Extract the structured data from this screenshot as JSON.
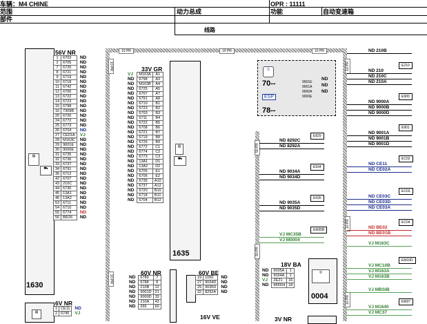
{
  "header": {
    "vehicle_label": "车辆：M4 CHINE",
    "opr_label": "OPR : 11111",
    "scope_label": "范围",
    "scope_value": "动力总成",
    "function_label": "功能",
    "function_value": "自动变速箱",
    "part_label": "部件",
    "section_title": "线路"
  },
  "harness_tags": [
    "10 PR",
    "10 PR",
    "10 PR",
    "10 PR",
    "10 PR",
    "50 PR",
    "50 PR",
    "10 PR",
    "10 PR",
    "10 PR"
  ],
  "conn_1630": {
    "title": "56V NR",
    "number": "1630",
    "pins": [
      [
        "1",
        "6703",
        "ND"
      ],
      [
        "2",
        "6705",
        "ND"
      ],
      [
        "7",
        "6720",
        "ND"
      ],
      [
        "8",
        "6721",
        "ND"
      ],
      [
        "9",
        "6719",
        "ND"
      ],
      [
        "10",
        "6718",
        "ND"
      ],
      [
        "11",
        "6742",
        "ND"
      ],
      [
        "12",
        "6706",
        "ND"
      ],
      [
        "13",
        "6722",
        "ND"
      ],
      [
        "14",
        "6723",
        "ND"
      ],
      [
        "15",
        "6798",
        "ND"
      ],
      [
        "16",
        "7309B",
        "ND"
      ],
      [
        "20",
        "6726",
        "ND"
      ],
      [
        "24",
        "6772",
        "ND"
      ],
      [
        "25",
        "6773",
        "ND"
      ],
      [
        "26",
        "6704",
        "ND"
      ],
      [
        "27",
        "CE01A",
        "VJ"
      ],
      [
        "28",
        "M163C",
        "ND"
      ],
      [
        "29",
        "9001E",
        "ND"
      ],
      [
        "30",
        "9000E",
        "ND"
      ],
      [
        "31",
        "6735",
        "ND"
      ],
      [
        "32",
        "6736",
        "ND"
      ],
      [
        "33",
        "6737",
        "ND"
      ],
      [
        "34",
        "6791",
        "ND"
      ],
      [
        "36",
        "6712",
        "ND"
      ],
      [
        "42",
        "6707",
        "ND"
      ],
      [
        "43",
        "210C",
        "ND"
      ],
      [
        "44",
        "6730",
        "ND"
      ],
      [
        "45",
        "13A1",
        "ND"
      ],
      [
        "46",
        "13A2",
        "ND"
      ],
      [
        "53",
        "6711",
        "ND"
      ],
      [
        "54",
        "6710",
        "ND"
      ],
      [
        "55",
        "6774",
        "ND"
      ],
      [
        "56",
        "BR26",
        "ND"
      ]
    ],
    "pin_colors": [
      "black",
      "black",
      "black",
      "black",
      "black",
      "black",
      "black",
      "black",
      "black",
      "black",
      "black",
      "black",
      "black",
      "black",
      "black",
      "navy",
      "green",
      "black",
      "black",
      "black",
      "black",
      "black",
      "black",
      "black",
      "black",
      "black",
      "black",
      "black",
      "black",
      "black",
      "black",
      "black",
      "red",
      "black"
    ]
  },
  "conn_6vnr": {
    "title": "6V NR",
    "pins": [
      [
        "1",
        "CE11",
        "ND"
      ],
      [
        "2",
        "6745",
        "VJ"
      ]
    ],
    "pin_colors": [
      "navy",
      "green"
    ]
  },
  "conn_1635": {
    "title": "33V GR",
    "number": "1635",
    "pins": [
      [
        "VJ",
        "M163A",
        "A1"
      ],
      [
        "ND",
        "6798",
        "A3"
      ],
      [
        "ND",
        "M163B",
        "A4"
      ],
      [
        "ND",
        "6725",
        "A5"
      ],
      [
        "ND",
        "6707",
        "A7"
      ],
      [
        "ND",
        "6791",
        "A8"
      ],
      [
        "ND",
        "6710",
        "B1"
      ],
      [
        "ND",
        "6723",
        "B2"
      ],
      [
        "ND",
        "6703",
        "B3"
      ],
      [
        "ND",
        "6711",
        "B4"
      ],
      [
        "ND",
        "6722",
        "B5"
      ],
      [
        "ND",
        "6708",
        "B6"
      ],
      [
        "ND",
        "6721",
        "B7"
      ],
      [
        "ND",
        "6719",
        "B8"
      ],
      [
        "ND",
        "6726",
        "B9"
      ],
      [
        "ND",
        "6772",
        "C1"
      ],
      [
        "ND",
        "6774",
        "C2"
      ],
      [
        "ND",
        "6773",
        "C3"
      ],
      [
        "ND",
        "13A1",
        "D1"
      ],
      [
        "ND",
        "13A2",
        "D2"
      ],
      [
        "ND",
        "6705",
        "E1"
      ],
      [
        "ND",
        "6706",
        "E2"
      ],
      [
        "ND",
        "6735",
        "A10"
      ],
      [
        "ND",
        "6737",
        "A12"
      ],
      [
        "ND",
        "6720",
        "B10"
      ],
      [
        "ND",
        "6718",
        "B11"
      ],
      [
        "ND",
        "6704",
        "B12"
      ]
    ],
    "pin_colors": [
      "green",
      "black",
      "black",
      "black",
      "black",
      "black",
      "black",
      "black",
      "black",
      "black",
      "black",
      "black",
      "black",
      "black",
      "black",
      "black",
      "black",
      "black",
      "black",
      "black",
      "black",
      "black",
      "black",
      "black",
      "black",
      "black",
      "black"
    ]
  },
  "conn_60vnr": {
    "title": "60V NR",
    "pins": [
      [
        "ND",
        "6789",
        "7"
      ],
      [
        "ND",
        "6788",
        "8"
      ],
      [
        "ND",
        "210B",
        "12"
      ],
      [
        "ND",
        "9001D",
        "21"
      ],
      [
        "ND",
        "9000D",
        "33"
      ],
      [
        "ND",
        "210A",
        "43"
      ],
      [
        "ND",
        "265",
        "60"
      ]
    ]
  },
  "conn_60vbe": {
    "title": "60V BE",
    "pins": [
      [
        "19",
        "1050",
        "ND"
      ],
      [
        "27",
        "9034D",
        "ND"
      ],
      [
        "29",
        "9035D",
        "ND"
      ],
      [
        "32",
        "8292A",
        "ND"
      ]
    ]
  },
  "conn_0004": {
    "title": "18V BA",
    "number": "0004",
    "pins": [
      [
        "ND",
        "9035A",
        "1"
      ],
      [
        "ND",
        "9034A",
        "2"
      ],
      [
        "VJ",
        "ZE21",
        "16"
      ],
      [
        "ND",
        "M0004",
        "18"
      ]
    ],
    "pin_colors": [
      "black",
      "black",
      "green",
      "black"
    ]
  },
  "conn_16vve": {
    "title": "16V VE"
  },
  "conn_3vnr": {
    "title": "3V NR"
  },
  "dashed_block": {
    "top_code": "70--",
    "bottom_code": "78--",
    "esp_label": "ESP",
    "codes": [
      "9001E",
      "9001A",
      "9000A",
      "9000E"
    ],
    "nds": [
      "ND",
      "ND",
      "ND"
    ]
  },
  "mid_labels": [
    {
      "tag": "E829",
      "lines": [
        [
          "ND 8292C",
          "black"
        ],
        [
          "ND 8292A",
          "black"
        ]
      ]
    },
    {
      "tag": "E934",
      "lines": [
        [
          "ND 9034A",
          "black"
        ],
        [
          "ND 9034D",
          "black"
        ]
      ]
    },
    {
      "tag": "E935",
      "lines": [
        [
          "ND 9035A",
          "black"
        ],
        [
          "ND 9035D",
          "black"
        ]
      ]
    },
    {
      "tag": "EM35B",
      "lines": [
        [
          "VJ MC35B",
          "green"
        ],
        [
          "VJ M0004",
          "green"
        ]
      ]
    }
  ],
  "right_groups": [
    {
      "tag": "",
      "lines": [
        [
          "ND 210B",
          "black"
        ]
      ]
    },
    {
      "tag": "E210",
      "lines": [
        [
          "ND 210",
          "black"
        ],
        [
          "ND 210C",
          "black"
        ],
        [
          "ND 210A",
          "black"
        ]
      ]
    },
    {
      "tag": "E900",
      "lines": [
        [
          "ND 9000A",
          "black"
        ],
        [
          "ND 9000B",
          "black"
        ],
        [
          "ND 9000D",
          "black"
        ]
      ]
    },
    {
      "tag": "E901",
      "lines": [
        [
          "ND 9001A",
          "black"
        ],
        [
          "ND 9001B",
          "black"
        ],
        [
          "ND 9001D",
          "black"
        ]
      ]
    },
    {
      "tag": "EC02",
      "lines": [
        [
          "ND CE11",
          "navy"
        ],
        [
          "ND CE02A",
          "navy"
        ]
      ]
    },
    {
      "tag": "EC03",
      "lines": [
        [
          "ND CE03C",
          "navy"
        ],
        [
          "ND CE03D",
          "navy"
        ],
        [
          "ND CE03A",
          "navy"
        ]
      ]
    },
    {
      "tag": "EC04",
      "lines": [
        [
          "ND BE02",
          "red"
        ],
        [
          "ND BE01B",
          "red"
        ]
      ]
    },
    {
      "tag": "",
      "lines": [
        [
          "VJ M163C",
          "green"
        ]
      ]
    },
    {
      "tag": "EM10D",
      "lines": [
        [
          "VJ MC10B",
          "green"
        ],
        [
          "VJ M163A",
          "green"
        ],
        [
          "VJ M163B",
          "green"
        ]
      ]
    },
    {
      "tag": "",
      "lines": [
        [
          "VJ MBSIB",
          "green"
        ]
      ]
    },
    {
      "tag": "EM37",
      "lines": [
        [
          "VJ M1640",
          "green"
        ],
        [
          "VJ MC37",
          "green"
        ]
      ]
    }
  ]
}
